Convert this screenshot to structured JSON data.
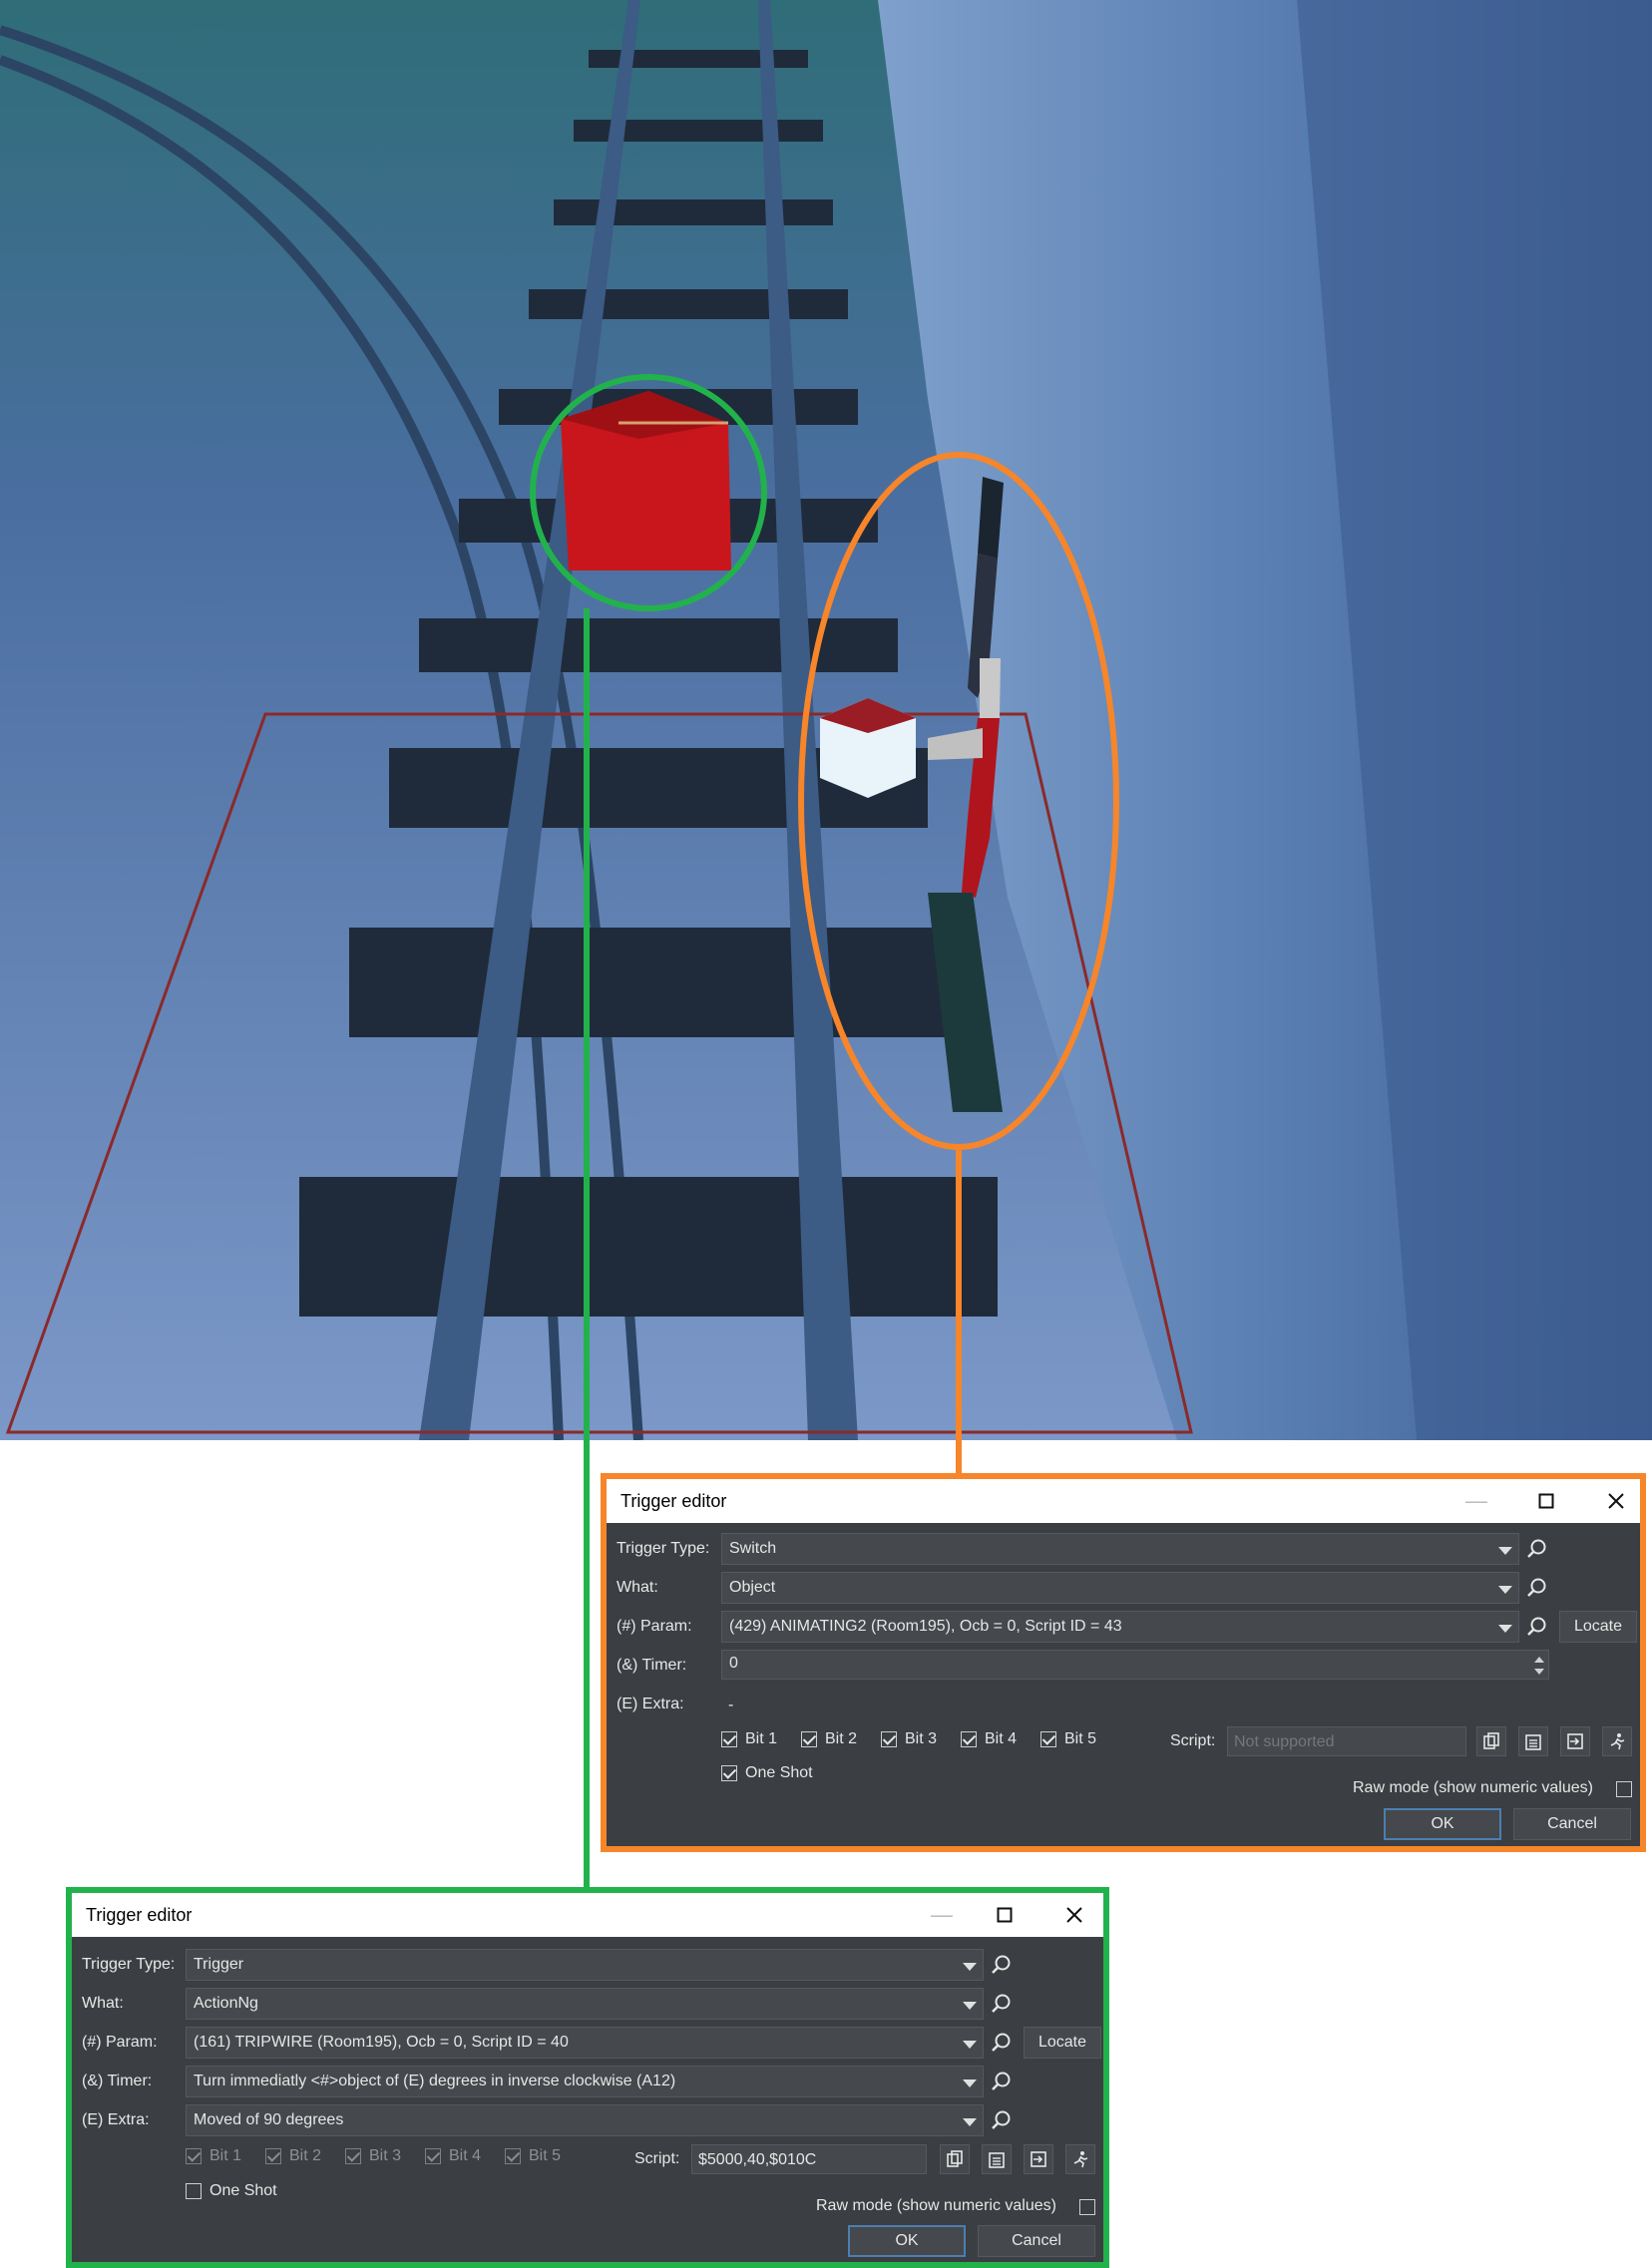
{
  "dialog_switch": {
    "title": "Trigger editor",
    "trigger_type_label": "Trigger Type:",
    "trigger_type_value": "Switch",
    "what_label": "What:",
    "what_value": "Object",
    "param_label": "(#) Param:",
    "param_value": "(429) ANIMATING2 (Room195), Ocb = 0, Script ID = 43",
    "locate_label": "Locate",
    "timer_label": "(&) Timer:",
    "timer_value": "0",
    "extra_label": "(E) Extra:",
    "extra_value": "-",
    "bits": [
      "Bit 1",
      "Bit 2",
      "Bit 3",
      "Bit 4",
      "Bit 5"
    ],
    "one_shot_label": "One Shot",
    "script_label": "Script:",
    "script_value": "Not supported",
    "raw_mode_label": "Raw mode (show numeric values)",
    "ok_label": "OK",
    "cancel_label": "Cancel"
  },
  "dialog_trigger": {
    "title": "Trigger editor",
    "trigger_type_label": "Trigger Type:",
    "trigger_type_value": "Trigger",
    "what_label": "What:",
    "what_value": "ActionNg",
    "param_label": "(#) Param:",
    "param_value": "(161) TRIPWIRE (Room195), Ocb = 0, Script ID = 40",
    "locate_label": "Locate",
    "timer_label": "(&) Timer:",
    "timer_value": "Turn immediatly  <#>object of (E) degrees in inverse clockwise (A12)",
    "extra_label": "(E) Extra:",
    "extra_value": "Moved of 90 degrees",
    "bits": [
      "Bit 1",
      "Bit 2",
      "Bit 3",
      "Bit 4",
      "Bit 5"
    ],
    "one_shot_label": "One Shot",
    "script_label": "Script:",
    "script_value": "$5000,40,$010C",
    "raw_mode_label": "Raw mode (show numeric values)",
    "ok_label": "OK",
    "cancel_label": "Cancel"
  },
  "colors": {
    "highlight_green": "#22b24c",
    "highlight_orange": "#f7852a",
    "trigger_outline": "#8a2a2a",
    "dialog_bg": "#3b3e42"
  }
}
